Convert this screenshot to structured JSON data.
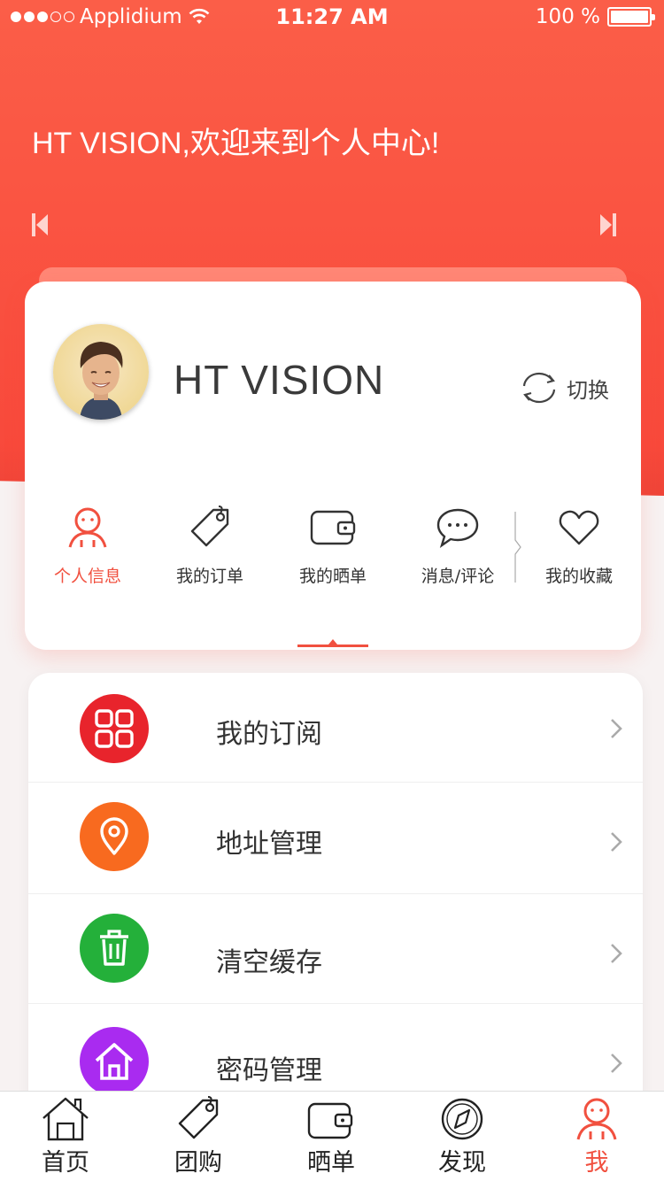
{
  "status_bar": {
    "carrier": "Applidium",
    "time": "11:27 AM",
    "battery": "100 %",
    "signal_bars_filled": 3,
    "signal_bars_total": 5
  },
  "header": {
    "welcome_text": "HT VISION,欢迎来到个人中心!"
  },
  "profile": {
    "name": "HT VISION",
    "switch_label": "切换"
  },
  "profile_tabs": [
    {
      "label": "个人信息",
      "icon": "person-icon",
      "active": true
    },
    {
      "label": "我的订单",
      "icon": "tag-icon",
      "active": false
    },
    {
      "label": "我的晒单",
      "icon": "wallet-icon",
      "active": false
    },
    {
      "label": "消息/评论",
      "icon": "chat-bubble-icon",
      "active": false
    },
    {
      "label": "我的收藏",
      "icon": "heart-icon",
      "active": false
    }
  ],
  "menu": [
    {
      "label": "我的订阅",
      "icon": "grid-icon",
      "color": "#e8242c"
    },
    {
      "label": "地址管理",
      "icon": "location-pin-icon",
      "color": "#f86a1f"
    },
    {
      "label": "清空缓存",
      "icon": "trash-icon",
      "color": "#24b03a"
    },
    {
      "label": "密码管理",
      "icon": "house-icon",
      "color": "#a92bf0"
    }
  ],
  "tabbar": [
    {
      "label": "首页",
      "icon": "home-icon",
      "active": false
    },
    {
      "label": "团购",
      "icon": "tag-icon",
      "active": false
    },
    {
      "label": "晒单",
      "icon": "wallet-icon",
      "active": false
    },
    {
      "label": "发现",
      "icon": "compass-icon",
      "active": false
    },
    {
      "label": "我",
      "icon": "person-icon",
      "active": true
    }
  ],
  "colors": {
    "accent": "#f1503f",
    "header_start": "#fb5e48",
    "header_end": "#f8473a"
  }
}
